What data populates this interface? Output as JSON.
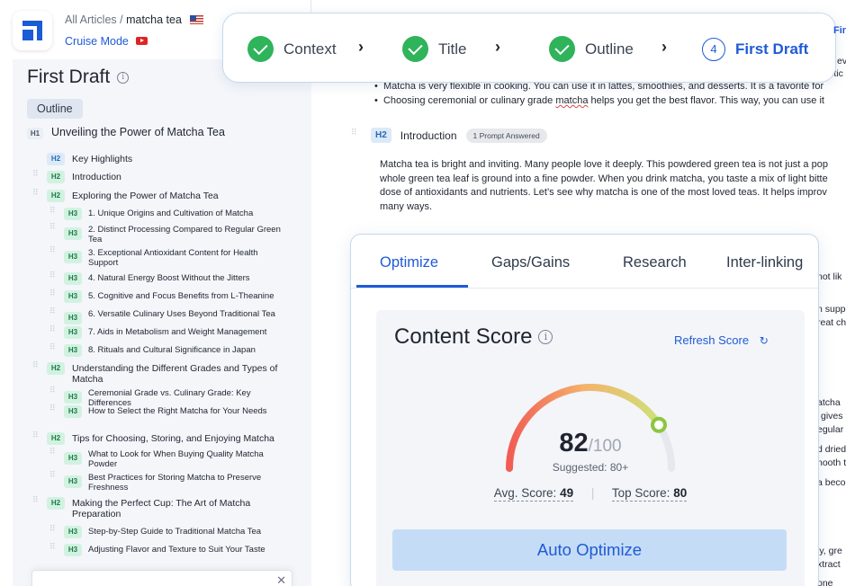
{
  "header": {
    "breadcrumb_prefix": "All Articles /",
    "breadcrumb_current": "matcha tea",
    "flag_icon": "us-flag-icon",
    "cruise_mode": "Cruise Mode",
    "cruise_icon": "youtube-icon"
  },
  "sidebar": {
    "title": "First Draft",
    "outline_button": "Outline",
    "items": [
      {
        "tag": "H1",
        "text": "Unveiling the Power of Matcha Tea"
      },
      {
        "tag": "H2",
        "text": "Key Highlights"
      },
      {
        "tag": "H2",
        "text": "Introduction"
      },
      {
        "tag": "H2",
        "text": "Exploring the Power of Matcha Tea"
      },
      {
        "tag": "H3",
        "text": "1. Unique Origins and Cultivation of Matcha"
      },
      {
        "tag": "H3",
        "text": "2. Distinct Processing Compared to Regular Green Tea"
      },
      {
        "tag": "H3",
        "text": "3. Exceptional Antioxidant Content for Health Support"
      },
      {
        "tag": "H3",
        "text": "4. Natural Energy Boost Without the Jitters"
      },
      {
        "tag": "H3",
        "text": "5. Cognitive and Focus Benefits from L-Theanine"
      },
      {
        "tag": "H3",
        "text": "6. Versatile Culinary Uses Beyond Traditional Tea"
      },
      {
        "tag": "H3",
        "text": "7. Aids in Metabolism and Weight Management"
      },
      {
        "tag": "H3",
        "text": "8. Rituals and Cultural Significance in Japan"
      },
      {
        "tag": "H2",
        "text": "Understanding the Different Grades and Types of Matcha"
      },
      {
        "tag": "H3",
        "text": "Ceremonial Grade vs. Culinary Grade: Key Differences"
      },
      {
        "tag": "H3",
        "text": "How to Select the Right Matcha for Your Needs"
      },
      {
        "tag": "H2",
        "text": "Tips for Choosing, Storing, and Enjoying Matcha"
      },
      {
        "tag": "H3",
        "text": "What to Look for When Buying Quality Matcha Powder"
      },
      {
        "tag": "H3",
        "text": "Best Practices for Storing Matcha to Preserve Freshness"
      },
      {
        "tag": "H2",
        "text": "Making the Perfect Cup: The Art of Matcha Preparation"
      },
      {
        "tag": "H3",
        "text": "Step-by-Step Guide to Traditional Matcha Tea"
      },
      {
        "tag": "H3",
        "text": "Adjusting Flavor and Texture to Suit Your Taste"
      }
    ]
  },
  "stepper": {
    "steps": [
      {
        "label": "Context",
        "state": "done"
      },
      {
        "label": "Title",
        "state": "done"
      },
      {
        "label": "Outline",
        "state": "done"
      },
      {
        "label": "First Draft",
        "state": "active",
        "number": "4"
      }
    ],
    "overflow_label": "Fir"
  },
  "editor": {
    "bullets_top": [
      "ev",
      "itic"
    ],
    "bullet_1": "Matcha is very flexible in cooking. You can use it in lattes, smoothies, and desserts. It is a favorite for",
    "bullet_2_pre": "Choosing ceremonial or culinary grade ",
    "bullet_2_word": "matcha",
    "bullet_2_post": " helps you get the best flavor. This way, you can use it",
    "section_tag": "H2",
    "section_label": "Introduction",
    "prompt_badge": "1 Prompt Answered",
    "para_lines": [
      "Matcha tea is bright and inviting. Many people love it deeply. This powdered green tea is not just a pop",
      "whole green tea leaf is ground into a fine powder. When you drink matcha, you taste a mix of light bitte",
      "dose of antioxidants and nutrients. Let’s see why matcha is one of the most loved teas. It helps improv",
      "many ways."
    ],
    "right_fragments": [
      "not lik",
      "n supp",
      "reat ch",
      "atcha",
      "gives",
      "egular",
      "d dried",
      "nooth t",
      "a beco",
      "ly, gre",
      "xtract",
      "one"
    ]
  },
  "optimize": {
    "tabs": [
      "Optimize",
      "Gaps/Gains",
      "Research",
      "Inter-linking"
    ],
    "active_tab": "Optimize",
    "content_score_title": "Content Score",
    "refresh_label": "Refresh Score",
    "score": 82,
    "score_max_label": "/100",
    "suggested": "Suggested: 80+",
    "avg_label": "Avg. Score:",
    "avg_value": "49",
    "top_label": "Top Score:",
    "top_value": "80",
    "auto_optimize": "Auto Optimize"
  },
  "colors": {
    "accent": "#1f5bd6",
    "success": "#2fb35b",
    "gauge_start": "#f25c54",
    "gauge_mid": "#f5b26b",
    "gauge_end": "#cfe07a"
  }
}
